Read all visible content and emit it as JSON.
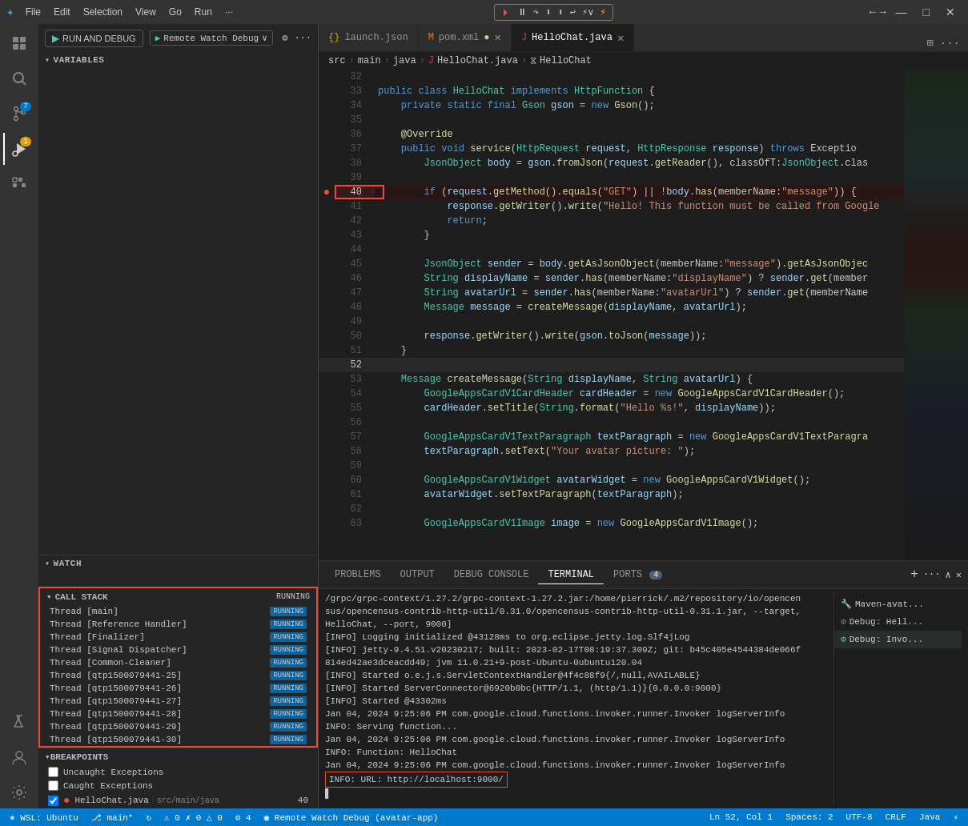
{
  "topToolbar": {
    "icons": [
      "❚❚",
      "⏸",
      "↺",
      "⬇",
      "⬆",
      "↩",
      "⚡"
    ],
    "debugConfig": "Remote Watch Debug",
    "runDebugLabel": "RUN AND DEBUG"
  },
  "activityBar": {
    "items": [
      {
        "name": "explorer",
        "icon": "⎘",
        "badge": null
      },
      {
        "name": "search",
        "icon": "🔍",
        "badge": null
      },
      {
        "name": "source-control",
        "icon": "⑂",
        "badge": "7"
      },
      {
        "name": "run-debug",
        "icon": "▷",
        "badge": "1"
      },
      {
        "name": "extensions",
        "icon": "⊞",
        "badge": null
      },
      {
        "name": "testing",
        "icon": "⚗",
        "badge": null
      }
    ]
  },
  "sidebar": {
    "variables": {
      "header": "VARIABLES"
    },
    "watch": {
      "header": "WATCH"
    },
    "callStack": {
      "header": "CALL STACK",
      "status": "Running",
      "threads": [
        {
          "name": "Thread [main]",
          "status": "RUNNING"
        },
        {
          "name": "Thread [Reference Handler]",
          "status": "RUNNING"
        },
        {
          "name": "Thread [Finalizer]",
          "status": "RUNNING"
        },
        {
          "name": "Thread [Signal Dispatcher]",
          "status": "RUNNING"
        },
        {
          "name": "Thread [Common-Cleaner]",
          "status": "RUNNING"
        },
        {
          "name": "Thread [qtp1500079441-25]",
          "status": "RUNNING"
        },
        {
          "name": "Thread [qtp1500079441-26]",
          "status": "RUNNING"
        },
        {
          "name": "Thread [qtp1500079441-27]",
          "status": "RUNNING"
        },
        {
          "name": "Thread [qtp1500079441-28]",
          "status": "RUNNING"
        },
        {
          "name": "Thread [qtp1500079441-29]",
          "status": "RUNNING"
        },
        {
          "name": "Thread [qtp1500079441-30]",
          "status": "RUNNING"
        }
      ]
    },
    "breakpoints": {
      "header": "BREAKPOINTS",
      "items": [
        {
          "type": "checkbox",
          "label": "Uncaught Exceptions",
          "checked": false
        },
        {
          "type": "checkbox",
          "label": "Caught Exceptions",
          "checked": false
        },
        {
          "type": "breakpoint",
          "label": "HelloChat.java",
          "path": "src/main/java",
          "line": "40",
          "active": true
        }
      ]
    }
  },
  "editor": {
    "tabs": [
      {
        "label": "launch.json",
        "icon": "{}",
        "active": false,
        "modified": false
      },
      {
        "label": "pom.xml",
        "icon": "M",
        "active": false,
        "modified": true
      },
      {
        "label": "HelloChat.java",
        "icon": "J",
        "active": true,
        "modified": false
      }
    ],
    "breadcrumb": [
      "src",
      "main",
      "java",
      "HelloChat.java",
      "HelloChat"
    ],
    "lines": [
      {
        "num": 32,
        "content": ""
      },
      {
        "num": 33,
        "content": "    <kw>public</kw> <kw>class</kw> <type>HelloChat</type> <kw>implements</kw> <type>HttpFunction</type> {"
      },
      {
        "num": 34,
        "content": "        <kw>private</kw> <kw>static</kw> <kw>final</kw> <type>Gson</type> <var>gson</var> = <kw>new</kw> <fn>Gson</fn>();"
      },
      {
        "num": 35,
        "content": ""
      },
      {
        "num": 36,
        "content": "        <annot>@Override</annot>"
      },
      {
        "num": 37,
        "content": "        <kw>public</kw> <kw>void</kw> <fn>service</fn>(<type>HttpRequest</type> <var>request</var>, <type>HttpResponse</type> <var>response</var>) <kw>throws</kw> Exceptio"
      },
      {
        "num": 38,
        "content": "            <type>JsonObject</type> <var>body</var> = <var>gson</var>.<fn>fromJson</fn>(<var>request</var>.<fn>getReader</fn>(), classOfT:<type>JsonObject</type>.clas"
      },
      {
        "num": 39,
        "content": ""
      },
      {
        "num": 40,
        "content": "            <kw>if</kw> (<var>request</var>.<fn>getMethod</fn>().<fn>equals</fn>(<str>\"GET\"</str>) || !<var>body</var>.<fn>has</fn>(memberName:<str>\"message\"</str>)) {",
        "breakpoint": true,
        "active": true
      },
      {
        "num": 41,
        "content": "                <var>response</var>.<fn>getWriter</fn>().<fn>write</fn>(<str>\"Hello! This function must be called from Google</str>"
      },
      {
        "num": 42,
        "content": "                <kw>return</kw>;"
      },
      {
        "num": 43,
        "content": "            }"
      },
      {
        "num": 44,
        "content": ""
      },
      {
        "num": 45,
        "content": "            <type>JsonObject</type> <var>sender</var> = <var>body</var>.<fn>getAsJsonObject</fn>(memberName:<str>\"message\"</str>).<fn>getAsJsonObjec</fn>"
      },
      {
        "num": 46,
        "content": "            <type>String</type> <var>displayName</var> = <var>sender</var>.<fn>has</fn>(memberName:<str>\"displayName\"</str>) ? <var>sender</var>.<fn>get</fn>(member"
      },
      {
        "num": 47,
        "content": "            <type>String</type> <var>avatarUrl</var> = <var>sender</var>.<fn>has</fn>(memberName:<str>\"avatarUrl\"</str>) ? <var>sender</var>.<fn>get</fn>(memberName"
      },
      {
        "num": 48,
        "content": "            <type>Message</type> <var>message</var> = <fn>createMessage</fn>(<var>displayName</var>, <var>avatarUrl</var>);"
      },
      {
        "num": 49,
        "content": ""
      },
      {
        "num": 50,
        "content": "            <var>response</var>.<fn>getWriter</fn>().<fn>write</fn>(<var>gson</var>.<fn>toJson</fn>(<var>message</var>));"
      },
      {
        "num": 51,
        "content": "        }"
      },
      {
        "num": 52,
        "content": ""
      },
      {
        "num": 53,
        "content": "        <type>Message</type> <fn>createMessage</fn>(<type>String</type> <var>displayName</var>, <type>String</type> <var>avatarUrl</var>) {"
      },
      {
        "num": 54,
        "content": "            <type>GoogleAppsCardV1CardHeader</type> <var>cardHeader</var> = <kw>new</kw> <fn>GoogleAppsCardV1CardHeader</fn>();"
      },
      {
        "num": 55,
        "content": "            <var>cardHeader</var>.<fn>setTitle</fn>(<type>String</type>.<fn>format</fn>(<str>\"Hello %s!\"</str>, <var>displayName</var>));"
      },
      {
        "num": 56,
        "content": ""
      },
      {
        "num": 57,
        "content": "            <type>GoogleAppsCardV1TextParagraph</type> <var>textParagraph</var> = <kw>new</kw> <fn>GoogleAppsCardV1TextParagra</fn>"
      },
      {
        "num": 58,
        "content": "            <var>textParagraph</var>.<fn>setText</fn>(<str>\"Your avatar picture: \"</str>);"
      },
      {
        "num": 59,
        "content": ""
      },
      {
        "num": 60,
        "content": "            <type>GoogleAppsCardV1Widget</type> <var>avatarWidget</var> = <kw>new</kw> <fn>GoogleAppsCardV1Widget</fn>();"
      },
      {
        "num": 61,
        "content": "            <var>avatarWidget</var>.<fn>setTextParagraph</fn>(<var>textParagraph</var>);"
      },
      {
        "num": 62,
        "content": ""
      },
      {
        "num": 63,
        "content": "            <type>GoogleAppsCardV1Image</type> <var>image</var> = <kw>new</kw> <fn>GoogleAppsCardV1Image</fn>();"
      }
    ]
  },
  "panel": {
    "tabs": [
      "PROBLEMS",
      "OUTPUT",
      "DEBUG CONSOLE",
      "TERMINAL",
      "PORTS"
    ],
    "portsCount": "4",
    "activeTab": "TERMINAL",
    "terminalLines": [
      "/grpc/grpc-context/1.27.2/grpc-context-1.27.2.jar:/home/pierrick/.m2/repository/io/opencen",
      "sus/opencensus-contrib-http-util/0.31.0/opencensus-contrib-http-util-0.31.1.jar, --target,",
      "HelloChat, --port, 9000]",
      "[INFO] Logging initialized @43128ms to org.eclipse.jetty.log.Slf4jLog",
      "[INFO] jetty-9.4.51.v20230217; built: 2023-02-17T08:19:37.309Z; git: b45c405e4544384de066f",
      "814ed42ae3dceacdd49; jvm 11.0.21+9-post-Ubuntu-0ubuntu120.04",
      "[INFO] Started o.e.j.s.ServletContextHandler@4f4c88f9{/,null,AVAILABLE}",
      "[INFO] Started ServerConnector@6920b0bc{HTTP/1.1, (http/1.1)}{0.0.0.0:9000}",
      "[INFO] Started @43302ms",
      "Jan 04, 2024 9:25:06 PM com.google.cloud.functions.invoker.runner.Invoker logServerInfo",
      "INFO: Serving function...",
      "Jan 04, 2024 9:25:06 PM com.google.cloud.functions.invoker.runner.Invoker logServerInfo",
      "INFO: Function: HelloChat",
      "Jan 04, 2024 9:25:06 PM com.google.cloud.functions.invoker.runner.Invoker logServerInfo",
      "INFO: URL: http://localhost:9000/"
    ],
    "highlightedLine": "INFO: URL: http://localhost:9000/",
    "cursor": "▋",
    "sidebarItems": [
      {
        "label": "Maven-avat...",
        "icon": "🔧"
      },
      {
        "label": "Debug: Hell...",
        "icon": "⚙"
      },
      {
        "label": "Debug: Invo...",
        "icon": "⚙",
        "active": true
      }
    ]
  },
  "statusBar": {
    "left": [
      {
        "label": "⎇ WSL: Ubuntu",
        "icon": "remote"
      },
      {
        "label": "⎇ main*",
        "icon": "branch"
      },
      {
        "label": "⊙",
        "icon": "sync"
      },
      {
        "label": "⚠ 0  ✗ 0  △ 0",
        "icon": "errors"
      },
      {
        "label": "⚙ 4",
        "icon": "debug"
      },
      {
        "label": "◉ Remote Watch Debug (avatar-app)",
        "icon": "debug-remote"
      }
    ],
    "right": [
      {
        "label": "Ln 52, Col 1"
      },
      {
        "label": "Spaces: 2"
      },
      {
        "label": "UTF-8"
      },
      {
        "label": "CRLF"
      },
      {
        "label": "Java"
      },
      {
        "label": "⚡"
      }
    ]
  }
}
